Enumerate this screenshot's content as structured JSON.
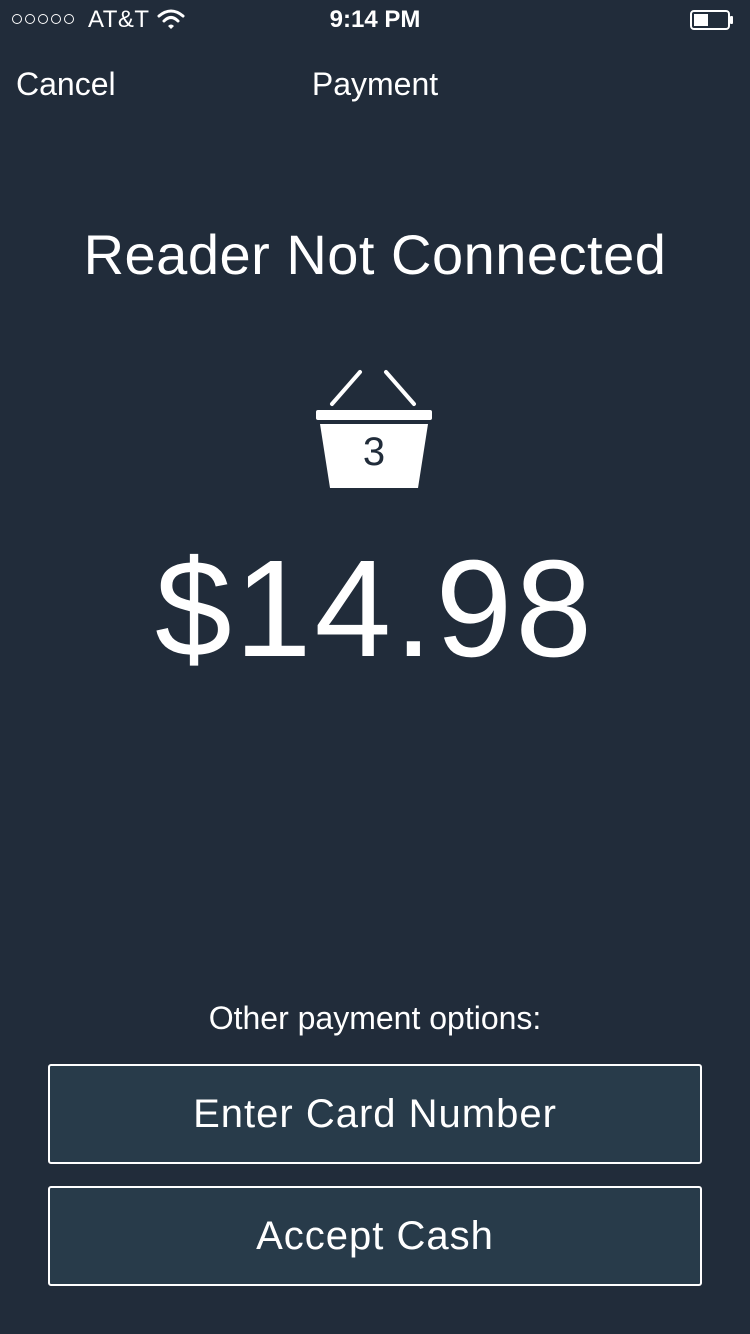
{
  "status_bar": {
    "signal_dots": 5,
    "carrier": "AT&T",
    "time": "9:14 PM",
    "battery_icon": "battery-icon",
    "wifi_icon": "wifi-icon"
  },
  "nav": {
    "cancel_label": "Cancel",
    "title": "Payment"
  },
  "main": {
    "reader_status": "Reader Not Connected",
    "basket_icon": "basket-icon",
    "basket_count": "3",
    "amount": "$14.98"
  },
  "payment_options": {
    "label": "Other payment options:",
    "buttons": [
      {
        "label": "Enter Card Number"
      },
      {
        "label": "Accept Cash"
      }
    ]
  },
  "colors": {
    "background": "#212c3a",
    "button_fill": "#283b4a",
    "text": "#ffffff"
  }
}
